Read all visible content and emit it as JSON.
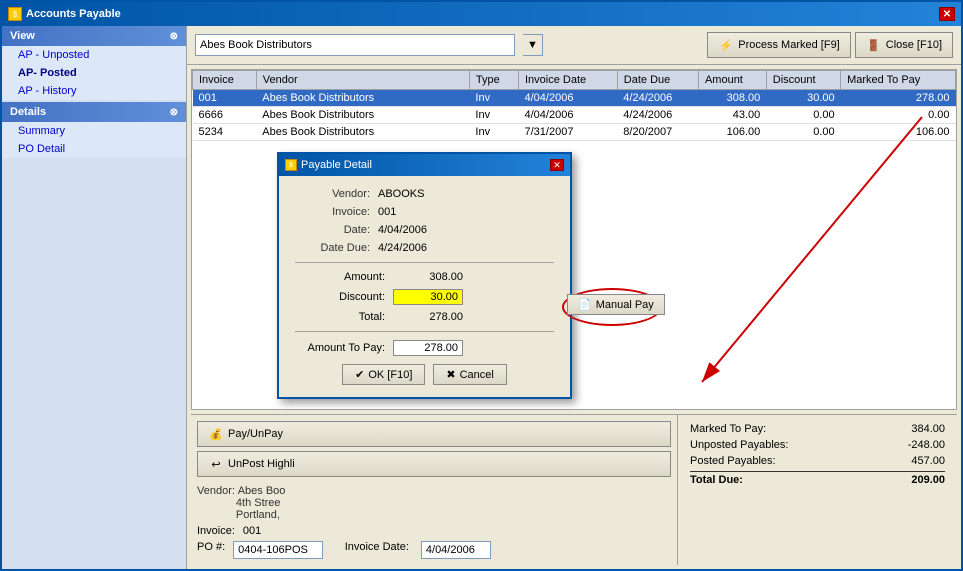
{
  "window": {
    "title": "Accounts Payable",
    "close_label": "✕"
  },
  "toolbar": {
    "vendor_value": "Abes Book Distributors",
    "vendor_dropdown_arrow": "▼",
    "process_btn": "Process Marked [F9]",
    "close_btn": "Close [F10]"
  },
  "sidebar": {
    "view_header": "View",
    "details_header": "Details",
    "view_items": [
      {
        "label": "AP - Unposted",
        "active": false
      },
      {
        "label": "AP- Posted",
        "active": true
      },
      {
        "label": "AP - History",
        "active": false
      }
    ],
    "details_items": [
      {
        "label": "Summary",
        "active": false
      },
      {
        "label": "PO Detail",
        "active": false
      }
    ]
  },
  "table": {
    "headers": [
      "Invoice",
      "Vendor",
      "Type",
      "Invoice Date",
      "Date Due",
      "Amount",
      "Discount",
      "Marked To Pay"
    ],
    "rows": [
      {
        "invoice": "001",
        "vendor": "Abes Book Distributors",
        "type": "Inv",
        "invoice_date": "4/04/2006",
        "date_due": "4/24/2006",
        "amount": "308.00",
        "discount": "30.00",
        "marked_to_pay": "278.00",
        "selected": true
      },
      {
        "invoice": "6666",
        "vendor": "Abes Book Distributors",
        "type": "Inv",
        "invoice_date": "4/04/2006",
        "date_due": "4/24/2006",
        "amount": "43.00",
        "discount": "0.00",
        "marked_to_pay": "0.00",
        "selected": false
      },
      {
        "invoice": "5234",
        "vendor": "Abes Book Distributors",
        "type": "Inv",
        "invoice_date": "7/31/2007",
        "date_due": "8/20/2007",
        "amount": "106.00",
        "discount": "0.00",
        "marked_to_pay": "106.00",
        "selected": false
      }
    ]
  },
  "bottom_left": {
    "pay_unpay_btn": "Pay/UnPay",
    "unpost_btn": "UnPost Highli",
    "vendor_label": "Vendor:",
    "vendor_name": "Abes Boo",
    "vendor_street": "4th Stree",
    "vendor_city": "Portland,",
    "invoice_label": "Invoice:",
    "invoice_value": "001",
    "po_label": "PO #:",
    "po_value": "0404-106POS",
    "invoice_date_label": "Invoice Date:",
    "invoice_date_value": "4/04/2006"
  },
  "summary": {
    "marked_to_pay_label": "Marked To Pay:",
    "marked_to_pay_value": "384.00",
    "unposted_label": "Unposted Payables:",
    "unposted_value": "-248.00",
    "posted_label": "Posted Payables:",
    "posted_value": "457.00",
    "total_label": "Total Due:",
    "total_value": "209.00"
  },
  "modal": {
    "title": "Payable Detail",
    "vendor_label": "Vendor:",
    "vendor_value": "ABOOKS",
    "invoice_label": "Invoice:",
    "invoice_value": "001",
    "date_label": "Date:",
    "date_value": "4/04/2006",
    "date_due_label": "Date Due:",
    "date_due_value": "4/24/2006",
    "amount_label": "Amount:",
    "amount_value": "308.00",
    "discount_label": "Discount:",
    "discount_value": "30.00",
    "total_label": "Total:",
    "total_value": "278.00",
    "amount_to_pay_label": "Amount To Pay:",
    "amount_to_pay_value": "278.00",
    "ok_btn": "OK [F10]",
    "cancel_btn": "Cancel",
    "manual_pay_btn": "Manual Pay"
  }
}
